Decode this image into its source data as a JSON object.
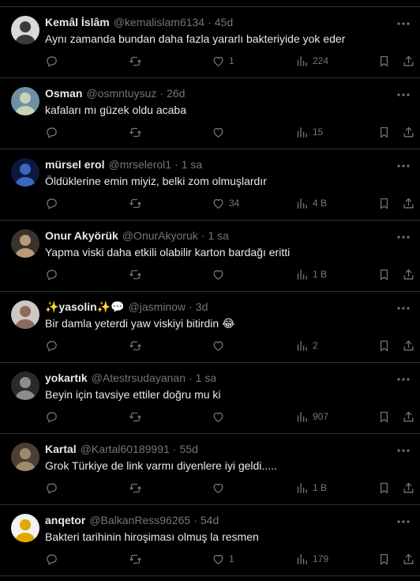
{
  "replies": [
    {
      "name": "Kemâl İslâm",
      "handle": "@kemalislam6134",
      "time": "45d",
      "text": "Aynı zamanda bundan daha fazla yararlı bakteriyide yok eder",
      "likes": "1",
      "views": "224",
      "avatar_bg": "#d9d9d9",
      "avatar_fg": "#3a3a3a"
    },
    {
      "name": "Osman",
      "handle": "@osmntuysuz",
      "time": "26d",
      "text": "kafaları mı güzek oldu acaba",
      "likes": "",
      "views": "15",
      "avatar_bg": "#6f8fa6",
      "avatar_fg": "#c9d3b4"
    },
    {
      "name": "mürsel erol",
      "handle": "@mrselerol1",
      "time": "1 sa",
      "text": "Öldüklerine emin miyiz,  belki zom olmuşlardır",
      "likes": "34",
      "views": "4 B",
      "avatar_bg": "#0b1a3a",
      "avatar_fg": "#3b66c4"
    },
    {
      "name": "Onur Akyörük",
      "handle": "@OnurAkyoruk",
      "time": "1 sa",
      "text": "Yapma viski daha etkili olabilir karton bardağı eritti",
      "likes": "",
      "views": "1 B",
      "avatar_bg": "#3b332b",
      "avatar_fg": "#b79a7a"
    },
    {
      "name": "✨yasolin✨💬",
      "handle": "@jasminow",
      "time": "3d",
      "text": "Bir damla yeterdi yaw viskiyi bitirdin 😂",
      "likes": "",
      "views": "2",
      "avatar_bg": "#cfc7c1",
      "avatar_fg": "#8a6a5a"
    },
    {
      "name": "yokartık",
      "handle": "@Atestrsudayanan",
      "time": "1 sa",
      "text": "Beyin için tavsiye ettiler doğru mu ki",
      "likes": "",
      "views": "907",
      "avatar_bg": "#2a2a2a",
      "avatar_fg": "#8c8c8c"
    },
    {
      "name": "Kartal",
      "handle": "@Kartal60189991",
      "time": "55d",
      "text": "Grok Türkiye de link varmı diyenlere iyi geldi.....",
      "likes": "",
      "views": "1 B",
      "avatar_bg": "#4a3f33",
      "avatar_fg": "#9e8a6e"
    },
    {
      "name": "anqetor",
      "handle": "@BalkanRess96265",
      "time": "54d",
      "text": "Bakteri tarihinin hiroşiması olmuş la resmen",
      "likes": "1",
      "views": "179",
      "avatar_bg": "#f2f2f2",
      "avatar_fg": "#e0a800"
    }
  ],
  "colors": {
    "bg": "#000000",
    "text": "#e7e9ea",
    "muted": "#71767b",
    "divider": "#2f3336"
  },
  "icons": {
    "reply": "reply-icon",
    "repost": "repost-icon",
    "like": "like-icon",
    "views": "views-icon",
    "bookmark": "bookmark-icon",
    "share": "share-icon",
    "more": "more-icon"
  }
}
